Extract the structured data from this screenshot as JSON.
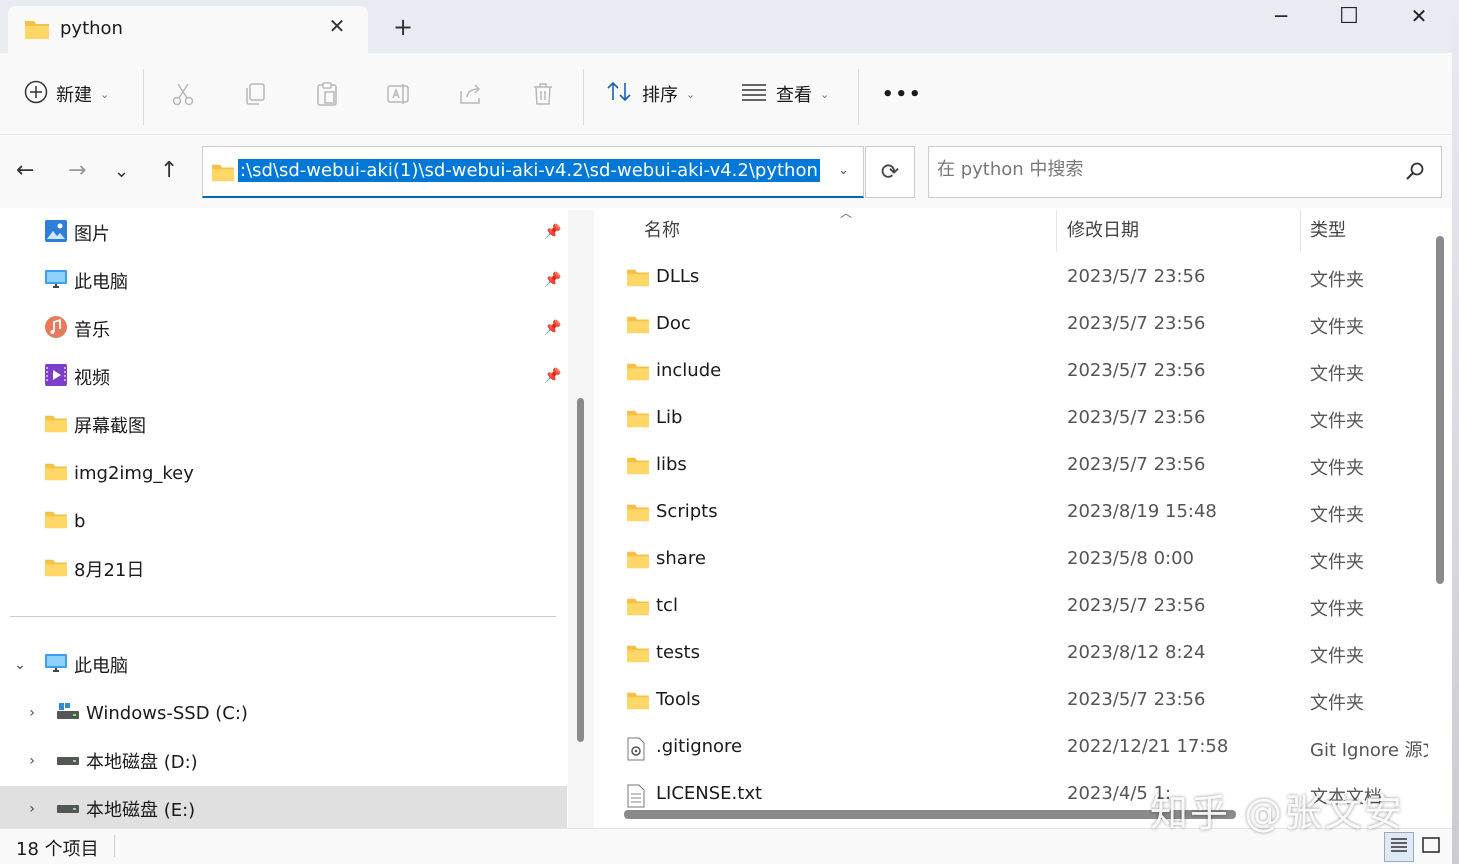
{
  "window": {
    "tab_title": "python",
    "new_tab_symbol": "+",
    "close_symbol": "✕",
    "minimize_symbol": "─",
    "maximize_symbol": "☐",
    "window_close_symbol": "✕"
  },
  "toolbar": {
    "new_label": "新建",
    "sort_label": "排序",
    "view_label": "查看",
    "more_label": "•••",
    "icons": [
      "cut-icon",
      "copy-icon",
      "paste-icon",
      "rename-icon",
      "share-icon",
      "delete-icon"
    ]
  },
  "address": {
    "path": ":\\sd\\sd-webui-aki(1)\\sd-webui-aki-v4.2\\sd-webui-aki-v4.2\\python",
    "search_placeholder": "在 python 中搜索"
  },
  "sidebar": {
    "quick_access": [
      {
        "label": "图片",
        "icon": "pictures-icon",
        "pinned": true
      },
      {
        "label": "此电脑",
        "icon": "computer-icon",
        "pinned": true
      },
      {
        "label": "音乐",
        "icon": "music-icon",
        "pinned": true
      },
      {
        "label": "视频",
        "icon": "video-icon",
        "pinned": true
      },
      {
        "label": "屏幕截图",
        "icon": "folder-icon",
        "pinned": false
      },
      {
        "label": "img2img_key",
        "icon": "folder-icon",
        "pinned": false
      },
      {
        "label": "b",
        "icon": "folder-icon",
        "pinned": false
      },
      {
        "label": "8月21日",
        "icon": "folder-icon",
        "pinned": false
      }
    ],
    "tree": [
      {
        "label": "此电脑",
        "expanded": true
      },
      {
        "label": "Windows-SSD (C:)"
      },
      {
        "label": "本地磁盘 (D:)"
      },
      {
        "label": "本地磁盘 (E:)",
        "selected": true
      }
    ]
  },
  "filelist": {
    "columns": {
      "name": "名称",
      "date": "修改日期",
      "type": "类型"
    },
    "rows": [
      {
        "name": "DLLs",
        "date": "2023/5/7 23:56",
        "type": "文件夹",
        "kind": "folder"
      },
      {
        "name": "Doc",
        "date": "2023/5/7 23:56",
        "type": "文件夹",
        "kind": "folder"
      },
      {
        "name": "include",
        "date": "2023/5/7 23:56",
        "type": "文件夹",
        "kind": "folder"
      },
      {
        "name": "Lib",
        "date": "2023/5/7 23:56",
        "type": "文件夹",
        "kind": "folder"
      },
      {
        "name": "libs",
        "date": "2023/5/7 23:56",
        "type": "文件夹",
        "kind": "folder"
      },
      {
        "name": "Scripts",
        "date": "2023/8/19 15:48",
        "type": "文件夹",
        "kind": "folder"
      },
      {
        "name": "share",
        "date": "2023/5/8 0:00",
        "type": "文件夹",
        "kind": "folder"
      },
      {
        "name": "tcl",
        "date": "2023/5/7 23:56",
        "type": "文件夹",
        "kind": "folder"
      },
      {
        "name": "tests",
        "date": "2023/8/12 8:24",
        "type": "文件夹",
        "kind": "folder"
      },
      {
        "name": "Tools",
        "date": "2023/5/7 23:56",
        "type": "文件夹",
        "kind": "folder"
      },
      {
        "name": ".gitignore",
        "date": "2022/12/21 17:58",
        "type": "Git Ignore 源文",
        "kind": "gitfile"
      },
      {
        "name": "LICENSE.txt",
        "date": "2023/4/5 1:",
        "type": "文本文档",
        "kind": "textfile"
      }
    ]
  },
  "status": {
    "item_count": "18 个项目"
  },
  "watermark": "知乎 @张文安"
}
